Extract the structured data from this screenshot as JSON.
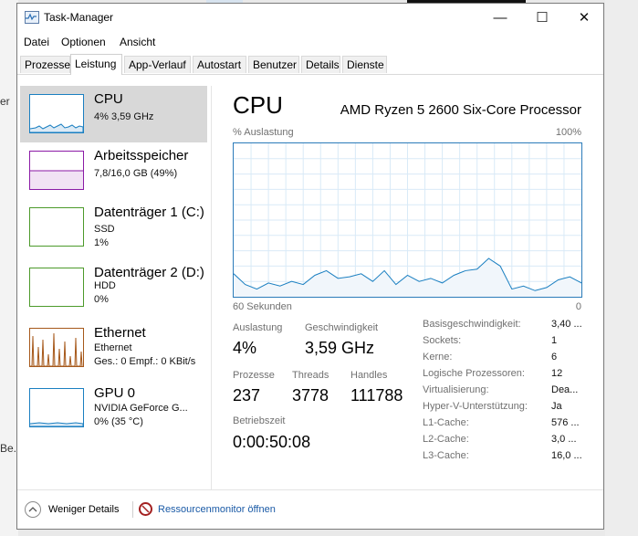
{
  "background": {
    "left_fragments": [
      "er",
      "Be."
    ]
  },
  "window": {
    "title": "Task-Manager",
    "controls": {
      "minimize": "—",
      "maximize": "☐",
      "close": "✕"
    }
  },
  "menu": [
    "Datei",
    "Optionen",
    "Ansicht"
  ],
  "tabs": [
    "Prozesse",
    "Leistung",
    "App-Verlauf",
    "Autostart",
    "Benutzer",
    "Details",
    "Dienste"
  ],
  "active_tab": "Leistung",
  "sidebar": {
    "items": [
      {
        "title": "CPU",
        "lines": [
          "4% 3,59 GHz"
        ],
        "color": "#1a7fc1"
      },
      {
        "title": "Arbeitsspeicher",
        "lines": [
          "7,8/16,0 GB (49%)"
        ],
        "color": "#8b1aa6"
      },
      {
        "title": "Datenträger 1 (C:)",
        "lines": [
          "SSD",
          "1%"
        ],
        "color": "#4c9a2a"
      },
      {
        "title": "Datenträger 2 (D:)",
        "lines": [
          "HDD",
          "0%"
        ],
        "color": "#4c9a2a"
      },
      {
        "title": "Ethernet",
        "lines": [
          "Ethernet",
          "Ges.: 0 Empf.: 0 KBit/s"
        ],
        "color": "#a6581a"
      },
      {
        "title": "GPU 0",
        "lines": [
          "NVIDIA GeForce G...",
          "0% (35 °C)"
        ],
        "color": "#1a7fc1"
      }
    ]
  },
  "main": {
    "title": "CPU",
    "processor": "AMD Ryzen 5 2600 Six-Core Processor",
    "graph": {
      "y_label": "% Auslastung",
      "y_max_label": "100%",
      "x_left_label": "60 Sekunden",
      "x_right_label": "0"
    },
    "stats": {
      "utilization": {
        "label": "Auslastung",
        "value": "4%"
      },
      "speed": {
        "label": "Geschwindigkeit",
        "value": "3,59 GHz"
      },
      "processes": {
        "label": "Prozesse",
        "value": "237"
      },
      "threads": {
        "label": "Threads",
        "value": "3778"
      },
      "handles": {
        "label": "Handles",
        "value": "111788"
      },
      "uptime": {
        "label": "Betriebszeit",
        "value": "0:00:50:08"
      }
    },
    "specs": [
      {
        "label": "Basisgeschwindigkeit:",
        "value": "3,40 ..."
      },
      {
        "label": "Sockets:",
        "value": "1"
      },
      {
        "label": "Kerne:",
        "value": "6"
      },
      {
        "label": "Logische Prozessoren:",
        "value": "12"
      },
      {
        "label": "Virtualisierung:",
        "value": "Dea..."
      },
      {
        "label": "Hyper-V-Unterstützung:",
        "value": "Ja"
      },
      {
        "label": "L1-Cache:",
        "value": "576 ..."
      },
      {
        "label": "L2-Cache:",
        "value": "3,0 ..."
      },
      {
        "label": "L3-Cache:",
        "value": "16,0 ..."
      }
    ]
  },
  "footer": {
    "less_details": "Weniger Details",
    "resmon": "Ressourcenmonitor öffnen"
  },
  "chart_data": {
    "type": "area",
    "title": "CPU",
    "ylabel": "% Auslastung",
    "xlabel": "60 Sekunden",
    "ylim": [
      0,
      100
    ],
    "x": [
      60,
      58,
      56,
      54,
      52,
      50,
      48,
      46,
      44,
      42,
      40,
      38,
      36,
      34,
      32,
      30,
      28,
      26,
      24,
      22,
      20,
      18,
      16,
      14,
      12,
      10,
      8,
      6,
      4,
      2,
      0
    ],
    "series": [
      {
        "values": [
          15,
          8,
          5,
          9,
          7,
          10,
          8,
          14,
          17,
          12,
          13,
          15,
          10,
          17,
          8,
          14,
          10,
          12,
          9,
          14,
          17,
          18,
          25,
          20,
          5,
          7,
          4,
          6,
          11,
          13,
          9
        ]
      }
    ],
    "grid": true
  }
}
